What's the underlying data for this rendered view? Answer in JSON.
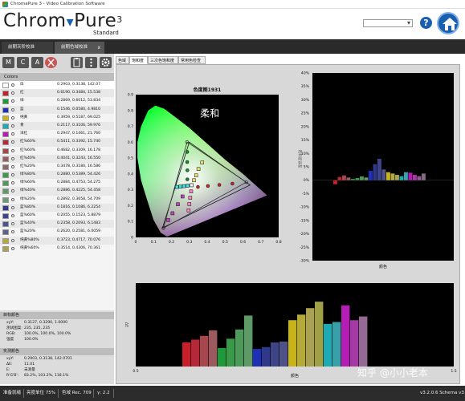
{
  "window": {
    "title": "ChromaPure 3 - Video Calibration Software"
  },
  "header": {
    "logo_prefix": "Chrom",
    "logo_suffix": "Pure",
    "logo_version": "3",
    "logo_sub": "Standard",
    "help": "?"
  },
  "doc_tabs": [
    {
      "label": "前期灰阶校准"
    },
    {
      "label": "前期色域校准",
      "close": "x"
    }
  ],
  "toolbar": {
    "m": "M",
    "c": "C",
    "a": "A"
  },
  "colors_header": "Colors",
  "colors": [
    {
      "name": "白",
      "value": "0.2903, 0.3138, 142.07",
      "color": "#ffffff"
    },
    {
      "name": "红",
      "value": "0.6190, 0.3484, 15.538",
      "color": "#c8202a"
    },
    {
      "name": "绿",
      "value": "0.2869, 0.6012, 53.834",
      "color": "#1e9a3a"
    },
    {
      "name": "蓝",
      "value": "0.1546, 0.0580, 4.9810",
      "color": "#1e2fb8"
    },
    {
      "name": "纯黄",
      "value": "0.3959, 0.5187, 69.025",
      "color": "#c8b418"
    },
    {
      "name": "青",
      "value": "0.2117, 0.3106, 59.976",
      "color": "#1eaab4"
    },
    {
      "name": "洋红",
      "value": "0.2947, 0.1461, 21.760",
      "color": "#b41eb4"
    },
    {
      "name": "红%60%",
      "value": "0.5411, 0.3392, 15.740",
      "color": "#b4283a"
    },
    {
      "name": "红%60%",
      "value": "0.4682, 0.3309, 16.178",
      "color": "#a8464e"
    },
    {
      "name": "红%40%",
      "value": "0.4041, 0.3243, 16.550",
      "color": "#9a5a5e"
    },
    {
      "name": "红%20%",
      "value": "0.3478, 0.3180, 16.586",
      "color": "#8a6a6c"
    },
    {
      "name": "绿%80%",
      "value": "0.2880, 0.5389, 54.426",
      "color": "#3a9a4a"
    },
    {
      "name": "绿%60%",
      "value": "0.2884, 0.4753, 54.275",
      "color": "#4e9a5a"
    },
    {
      "name": "绿%40%",
      "value": "0.2886, 0.4225, 54.458",
      "color": "#5e9a68"
    },
    {
      "name": "绿%20%",
      "value": "0.2892, 0.3658, 54.709",
      "color": "#6e9a76"
    },
    {
      "name": "蓝%80%",
      "value": "0.1816, 0.1086, 6.2254",
      "color": "#30388a"
    },
    {
      "name": "蓝%60%",
      "value": "0.2055, 0.1523, 5.8879",
      "color": "#3e4488"
    },
    {
      "name": "蓝%40%",
      "value": "0.2358, 0.2093, 6.1483",
      "color": "#4e5288"
    },
    {
      "name": "蓝%20%",
      "value": "0.2620, 0.2581, 6.0059",
      "color": "#5e6088"
    },
    {
      "name": "纯黄%80%",
      "value": "0.3723, 0.4717, 70.076",
      "color": "#b4aa3a"
    },
    {
      "name": "纯黄%60%",
      "value": "0.3514, 0.4306, 70.361",
      "color": "#aaa250"
    }
  ],
  "target": {
    "header": "目标颜色",
    "xyY": "0.3127, 0.3290, 1.0000",
    "measured": "235, 235, 235",
    "rgb": "100.0%, 100.0%, 100.0%",
    "intensity": "100.0%",
    "labels": {
      "xyY": "xyY:",
      "measured": "测试图案:",
      "rgb": "RGB:",
      "intensity": "强度"
    }
  },
  "measurement": {
    "header": "实测颜色",
    "xyY": "0.2903, 0.3138, 142.0701",
    "dE": "11.01",
    "E": "未测量",
    "rgb": "83.2%, 103.2%, 118.1%",
    "labels": {
      "xyY": "xyY:",
      "dE": "ΔE:",
      "E": "E:",
      "rgb": "R'G'B':"
    }
  },
  "tabs": [
    "色域",
    "饱和度",
    "三次色饱和度",
    "常用色检查"
  ],
  "statusbar": {
    "left": "准备就绪",
    "lum": "亮度单位 75%",
    "gamut": "色域 Rec. 709",
    "gamma": "γ: 2.2",
    "version": "v3.2.0.6 Schema v3"
  },
  "watermark": "知乎 @小小老本",
  "chart_data": [
    {
      "type": "scatter",
      "title": "色度图1931",
      "annotation": "柔和",
      "xlim": [
        0,
        0.8
      ],
      "ylim": [
        0,
        0.9
      ],
      "x_ticks": [
        "0",
        "0.1",
        "0.2",
        "0.3",
        "0.4",
        "0.5",
        "0.6",
        "0.7",
        "0.8"
      ],
      "y_ticks": [
        "0.9",
        "0.8",
        "0.7",
        "0.6",
        "0.5",
        "0.4",
        "0.3",
        "0.2",
        "0.1",
        "0"
      ],
      "target_gamut": [
        [
          0.64,
          0.33
        ],
        [
          0.3,
          0.6
        ],
        [
          0.15,
          0.06
        ]
      ],
      "measured_gamut": [
        [
          0.619,
          0.348
        ],
        [
          0.287,
          0.601
        ],
        [
          0.155,
          0.058
        ]
      ],
      "white": [
        0.3127,
        0.329
      ],
      "green_points": [
        [
          0.288,
          0.539
        ],
        [
          0.288,
          0.475
        ],
        [
          0.289,
          0.423
        ],
        [
          0.289,
          0.366
        ]
      ],
      "red_points": [
        [
          0.541,
          0.339
        ],
        [
          0.468,
          0.331
        ],
        [
          0.404,
          0.324
        ],
        [
          0.348,
          0.318
        ]
      ],
      "blue_points": [
        [
          0.182,
          0.109
        ],
        [
          0.206,
          0.152
        ],
        [
          0.236,
          0.209
        ],
        [
          0.262,
          0.258
        ]
      ],
      "yellow_points": [
        [
          0.372,
          0.472
        ],
        [
          0.351,
          0.431
        ],
        [
          0.338,
          0.391
        ],
        [
          0.326,
          0.36
        ]
      ],
      "cyan_points": [
        [
          0.23,
          0.318
        ],
        [
          0.25,
          0.32
        ],
        [
          0.27,
          0.323
        ],
        [
          0.29,
          0.326
        ]
      ],
      "magenta_points": [
        [
          0.296,
          0.17
        ],
        [
          0.3,
          0.21
        ],
        [
          0.305,
          0.25
        ],
        [
          0.31,
          0.29
        ]
      ]
    },
    {
      "type": "bar",
      "ylabel": "饱和度误差",
      "xlabel": "颜色",
      "ylim": [
        -30,
        40
      ],
      "y_ticks": [
        "40%",
        "35%",
        "30%",
        "25%",
        "20%",
        "15%",
        "10%",
        "5%",
        "0%",
        "-5%",
        "-10%",
        "-15%",
        "-20%",
        "-25%",
        "-30%"
      ],
      "colors": [
        "#c8202a",
        "#b4283a",
        "#a8464e",
        "#9a5a5e",
        "#1e9a3a",
        "#3a9a4a",
        "#4e9a5a",
        "#5e9a68",
        "#1e2fb8",
        "#30388a",
        "#3e4488",
        "#4e5288",
        "#c8b418",
        "#b4aa3a",
        "#aaa250",
        "#1eaab4",
        "#3aa0a8",
        "#b41eb4",
        "#a43aa4",
        "#945a94",
        "#846a84"
      ],
      "values": [
        -1.5,
        1.2,
        1.8,
        1.0,
        0.5,
        0.8,
        1.4,
        1.0,
        3.5,
        6.0,
        8.0,
        4.0,
        3.0,
        2.5,
        2.0,
        1.5,
        3.0,
        2.8,
        2.0,
        1.5,
        2.5
      ]
    },
    {
      "type": "bar",
      "ylabel": "ΔE",
      "xlabel": "颜色",
      "xlim": [
        0.5,
        1.5
      ],
      "x_ticks": [
        "0.5",
        "1.5"
      ],
      "colors": [
        "#c8202a",
        "#b4283a",
        "#a8464e",
        "#9a5a5e",
        "#1e9a3a",
        "#3a9a4a",
        "#4e9a5a",
        "#5e9a68",
        "#1e2fb8",
        "#30388a",
        "#3e4488",
        "#4e5288",
        "#c8b418",
        "#b4aa3a",
        "#aaa250",
        "#a0a048",
        "#1eaab4",
        "#3aa0a8",
        "#b41eb4",
        "#a43aa4",
        "#946a94"
      ],
      "values": [
        2.6,
        2.9,
        3.3,
        3.9,
        2.0,
        3.0,
        4.0,
        5.5,
        1.9,
        2.1,
        2.6,
        2.7,
        5.0,
        5.6,
        6.3,
        7.0,
        4.6,
        4.8,
        6.6,
        5.0,
        5.4
      ]
    }
  ]
}
